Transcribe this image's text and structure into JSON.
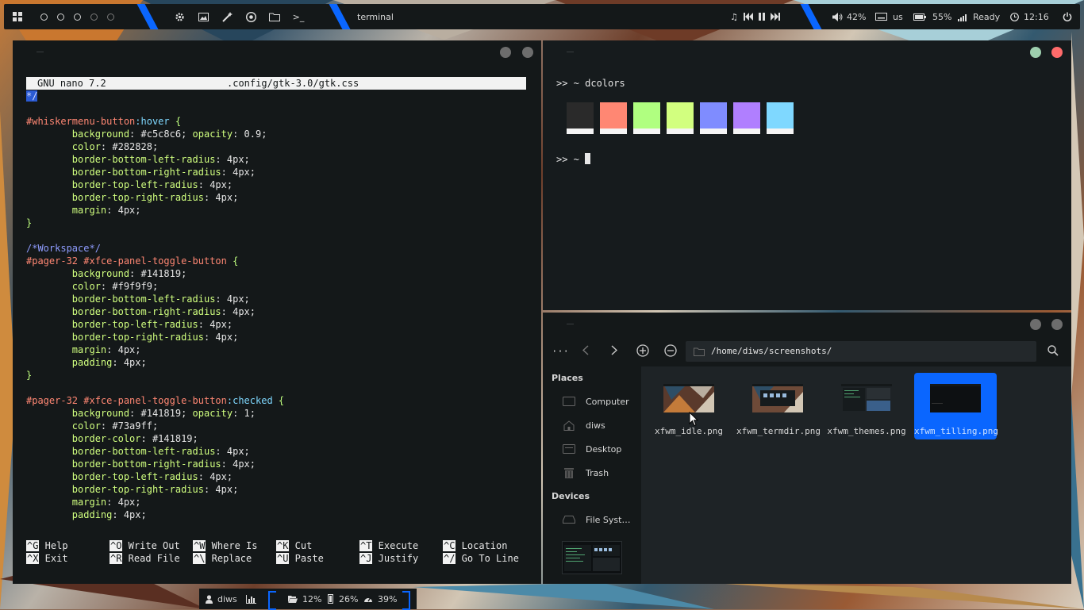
{
  "top_panel": {
    "active_window": "terminal",
    "volume": "42%",
    "keyboard": "us",
    "battery": "55%",
    "network": "Ready",
    "clock": "12:16",
    "launchers": [
      "settings-icon",
      "image-viewer-icon",
      "magic-wand-icon",
      "browser-icon",
      "folder-icon",
      "terminal-icon"
    ]
  },
  "nano": {
    "version": "GNU nano 7.2",
    "file": ".config/gtk-3.0/gtk.css",
    "lines": [
      [
        [
          "*/",
          "cursor"
        ]
      ],
      [],
      [
        [
          "#whiskermenu-button",
          "sel"
        ],
        [
          ":hover",
          "pc"
        ],
        [
          " {",
          "br"
        ]
      ],
      [
        [
          "        background",
          "prop"
        ],
        [
          ": #c5c8c6; ",
          "val"
        ],
        [
          "opacity",
          "prop"
        ],
        [
          ": 0.9;",
          "val"
        ]
      ],
      [
        [
          "        color",
          "prop"
        ],
        [
          ": #282828;",
          "val"
        ]
      ],
      [
        [
          "        border-bottom-left-radius",
          "prop"
        ],
        [
          ": 4px;",
          "val"
        ]
      ],
      [
        [
          "        border-bottom-right-radius",
          "prop"
        ],
        [
          ": 4px;",
          "val"
        ]
      ],
      [
        [
          "        border-top-left-radius",
          "prop"
        ],
        [
          ": 4px;",
          "val"
        ]
      ],
      [
        [
          "        border-top-right-radius",
          "prop"
        ],
        [
          ": 4px;",
          "val"
        ]
      ],
      [
        [
          "        margin",
          "prop"
        ],
        [
          ": 4px;",
          "val"
        ]
      ],
      [
        [
          "}",
          "br"
        ]
      ],
      [],
      [
        [
          "/*Workspace*/",
          "cm"
        ]
      ],
      [
        [
          "#pager-32 #xfce-panel-toggle-button",
          "sel"
        ],
        [
          " {",
          "br"
        ]
      ],
      [
        [
          "        background",
          "prop"
        ],
        [
          ": #141819;",
          "val"
        ]
      ],
      [
        [
          "        color",
          "prop"
        ],
        [
          ": #f9f9f9;",
          "val"
        ]
      ],
      [
        [
          "        border-bottom-left-radius",
          "prop"
        ],
        [
          ": 4px;",
          "val"
        ]
      ],
      [
        [
          "        border-bottom-right-radius",
          "prop"
        ],
        [
          ": 4px;",
          "val"
        ]
      ],
      [
        [
          "        border-top-left-radius",
          "prop"
        ],
        [
          ": 4px;",
          "val"
        ]
      ],
      [
        [
          "        border-top-right-radius",
          "prop"
        ],
        [
          ": 4px;",
          "val"
        ]
      ],
      [
        [
          "        margin",
          "prop"
        ],
        [
          ": 4px;",
          "val"
        ]
      ],
      [
        [
          "        padding",
          "prop"
        ],
        [
          ": 4px;",
          "val"
        ]
      ],
      [
        [
          "}",
          "br"
        ]
      ],
      [],
      [
        [
          "#pager-32 #xfce-panel-toggle-button",
          "sel"
        ],
        [
          ":checked",
          "pc"
        ],
        [
          " {",
          "br"
        ]
      ],
      [
        [
          "        background",
          "prop"
        ],
        [
          ": #141819; ",
          "val"
        ],
        [
          "opacity",
          "prop"
        ],
        [
          ": 1;",
          "val"
        ]
      ],
      [
        [
          "        color",
          "prop"
        ],
        [
          ": #73a9ff;",
          "val"
        ]
      ],
      [
        [
          "        border-color",
          "prop"
        ],
        [
          ": #141819;",
          "val"
        ]
      ],
      [
        [
          "        border-bottom-left-radius",
          "prop"
        ],
        [
          ": 4px;",
          "val"
        ]
      ],
      [
        [
          "        border-bottom-right-radius",
          "prop"
        ],
        [
          ": 4px;",
          "val"
        ]
      ],
      [
        [
          "        border-top-left-radius",
          "prop"
        ],
        [
          ": 4px;",
          "val"
        ]
      ],
      [
        [
          "        border-top-right-radius",
          "prop"
        ],
        [
          ": 4px;",
          "val"
        ]
      ],
      [
        [
          "        margin",
          "prop"
        ],
        [
          ": 4px;",
          "val"
        ]
      ],
      [
        [
          "        padding",
          "prop"
        ],
        [
          ": 4px;",
          "val"
        ]
      ]
    ],
    "help": [
      {
        "k1": "^G",
        "l1": "Help",
        "k2": "^X",
        "l2": "Exit"
      },
      {
        "k1": "^O",
        "l1": "Write Out",
        "k2": "^R",
        "l2": "Read File"
      },
      {
        "k1": "^W",
        "l1": "Where Is",
        "k2": "^\\",
        "l2": "Replace"
      },
      {
        "k1": "^K",
        "l1": "Cut",
        "k2": "^U",
        "l2": "Paste"
      },
      {
        "k1": "^T",
        "l1": "Execute",
        "k2": "^J",
        "l2": "Justify"
      },
      {
        "k1": "^C",
        "l1": "Location",
        "k2": "^/",
        "l2": "Go To Line"
      }
    ]
  },
  "terminal": {
    "prompt1": ">> ~ dcolors",
    "prompt2": ">> ~ ",
    "swatches": [
      "#2a2a2a",
      "#ff8773",
      "#b0ff80",
      "#d2ff7f",
      "#7f8cff",
      "#b07fff",
      "#7fd8ff"
    ]
  },
  "file_manager": {
    "path": "/home/diws/screenshots/",
    "places_heading": "Places",
    "places": [
      {
        "label": "Computer",
        "icon": "computer-icon"
      },
      {
        "label": "diws",
        "icon": "home-icon"
      },
      {
        "label": "Desktop",
        "icon": "desktop-icon"
      },
      {
        "label": "Trash",
        "icon": "trash-icon"
      }
    ],
    "devices_heading": "Devices",
    "devices": [
      {
        "label": "File Syst…",
        "icon": "drive-icon"
      }
    ],
    "files": [
      {
        "name": "xfwm_idle.png",
        "selected": false
      },
      {
        "name": "xfwm_termdir.png",
        "selected": false
      },
      {
        "name": "xfwm_themes.png",
        "selected": false
      },
      {
        "name": "xfwm_tilling.png",
        "selected": true
      }
    ]
  },
  "bottom_panel": {
    "user": "diws",
    "folder": "12%",
    "memory": "26%",
    "cpu": "39%"
  }
}
